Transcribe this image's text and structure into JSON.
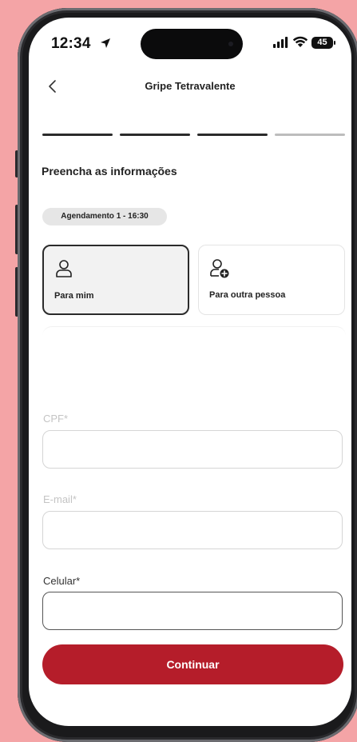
{
  "status_bar": {
    "time": "12:34",
    "battery": "45"
  },
  "nav": {
    "title": "Gripe Tetravalente"
  },
  "progress": {
    "total_steps": 4,
    "completed_steps": 3
  },
  "form": {
    "section_title": "Preencha as informações",
    "appointment_badge": "Agendamento 1 - 16:30",
    "options": [
      {
        "label": "Para mim",
        "selected": true
      },
      {
        "label": "Para outra pessoa",
        "selected": false
      }
    ],
    "fields": {
      "cpf": {
        "label": "CPF*",
        "value": ""
      },
      "email": {
        "label": "E-mail*",
        "value": ""
      },
      "phone": {
        "label": "Celular*",
        "value": ""
      }
    },
    "submit_label": "Continuar"
  },
  "colors": {
    "background": "#f4a4a6",
    "primary": "#b51d2a",
    "step_active": "#2b2b2b",
    "step_inactive": "#bdbdbd"
  }
}
